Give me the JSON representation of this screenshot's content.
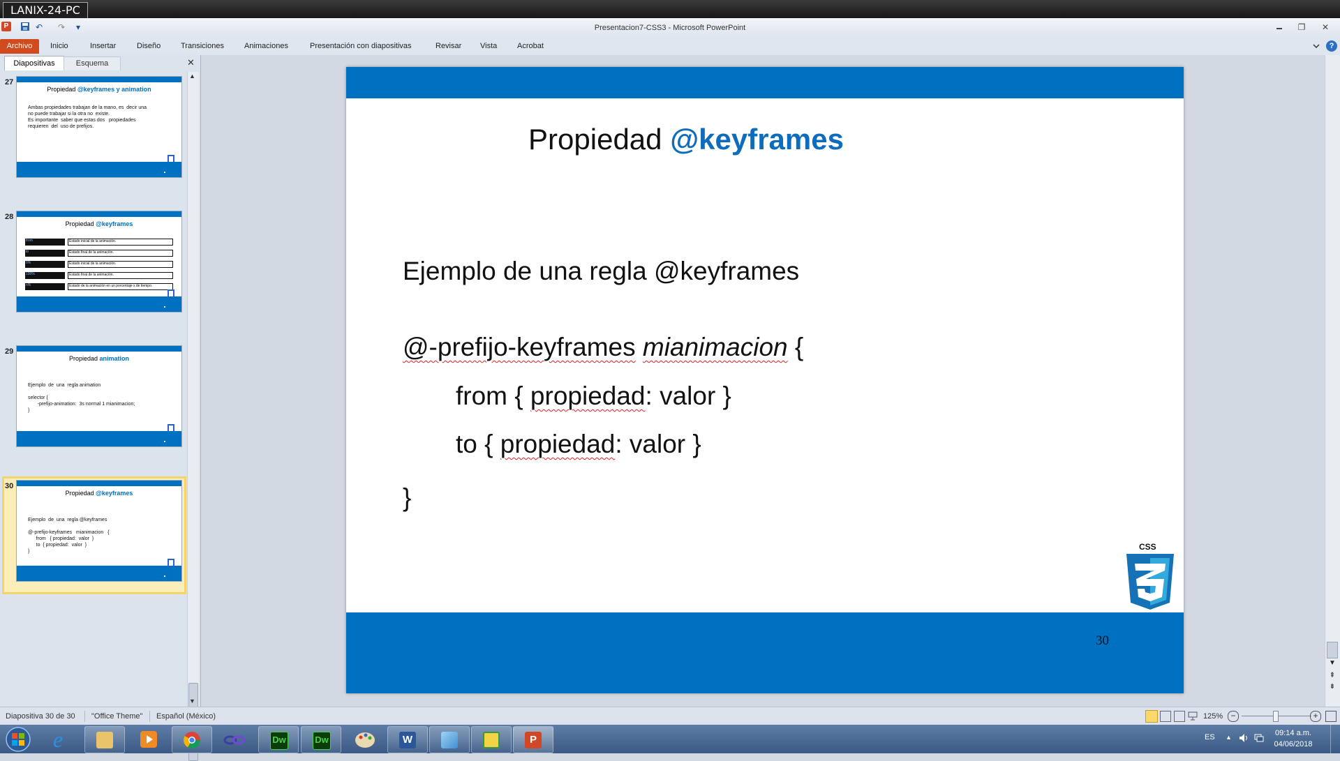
{
  "remote": {
    "host": "LANIX-24-PC"
  },
  "window": {
    "title": "Presentacion7-CSS3  -  Microsoft PowerPoint",
    "minimize": "▭",
    "restore": "❐",
    "close": "✕"
  },
  "quick_access": {
    "app_icon": "P",
    "save": "💾",
    "undo": "↶",
    "redo": "↷",
    "more": "▾"
  },
  "ribbon": {
    "file": "Archivo",
    "tabs": [
      "Inicio",
      "Insertar",
      "Diseño",
      "Transiciones",
      "Animaciones",
      "Presentación con diapositivas",
      "Revisar",
      "Vista",
      "Acrobat"
    ],
    "collapse": "♡",
    "help": "?"
  },
  "panel": {
    "tab_slides": "Diapositivas",
    "tab_outline": "Esquema",
    "close": "✕"
  },
  "thumbnails": [
    {
      "num": "27",
      "title_plain": "Propiedad ",
      "title_accent": "@keyframes y animation",
      "body": "Ambas propiedades trabajan de la mano, es  decir una\nno puede trabajar si la otra no  existe.\nEs importante  saber que estas dos   propiedades\nrequieren  del  uso de prefijos."
    },
    {
      "num": "28",
      "title_plain": "Propiedad ",
      "title_accent": "@keyframes",
      "rows": [
        {
          "key": "from",
          "desc": "Estado inicial de la animación."
        },
        {
          "key": "to",
          "desc": "Estado final de la animación."
        },
        {
          "key": "0%",
          "desc": "Estado inicial de la animación."
        },
        {
          "key": "100%",
          "desc": "Estado final de la animación."
        },
        {
          "key": "n%",
          "desc": "Estado de la animación en un porcentaje x de tiempo."
        }
      ]
    },
    {
      "num": "29",
      "title_plain": "Propiedad ",
      "title_accent": "animation",
      "body": "Ejemplo  de  una  regla animation\n\nselector {\n       -prefijo-animation:  3s normal 1 mianimacion;\n}"
    },
    {
      "num": "30",
      "title_plain": "Propiedad ",
      "title_accent": "@keyframes",
      "body": "Ejemplo  de  una  regla @keyframes\n\n@-prefijo-keyframes   mianimacion   {\n      from   { propiedad:  valor  }\n      to  { propiedad:  valor  }\n}"
    }
  ],
  "slide": {
    "title_plain": "Propiedad ",
    "title_accent": "@keyframes",
    "subtitle": "Ejemplo de una regla @keyframes",
    "line1_a": "@-prefijo-keyframes",
    "line1_b": "mianimacion",
    "line1_c": " {",
    "line2_a": "from  { ",
    "line2_b": "propiedad",
    "line2_c": ": valor }",
    "line3_a": "to  { ",
    "line3_b": "propiedad",
    "line3_c": ": valor }",
    "line4": "}",
    "number": "30",
    "logo_label": "CSS",
    "colors": {
      "bar": "#0070c0",
      "accent": "#0e6cbd"
    }
  },
  "status": {
    "slide_info": "Diapositiva 30 de 30",
    "theme": "\"Office Theme\"",
    "language": "Español (México)",
    "zoom": "125%"
  },
  "taskbar": {
    "apps": [
      "ie-icon",
      "explorer-icon",
      "media-player-icon",
      "chrome-icon",
      "network-icon",
      "dreamweaver-icon",
      "dreamweaver-icon-2",
      "paint-icon",
      "word-icon",
      "files-icon",
      "picture-icon",
      "powerpoint-icon"
    ],
    "dw_label": "Dw",
    "word_label": "W",
    "ppt_label": "P",
    "lang": "ES",
    "time": "09:14 a.m.",
    "date": "04/06/2018"
  }
}
